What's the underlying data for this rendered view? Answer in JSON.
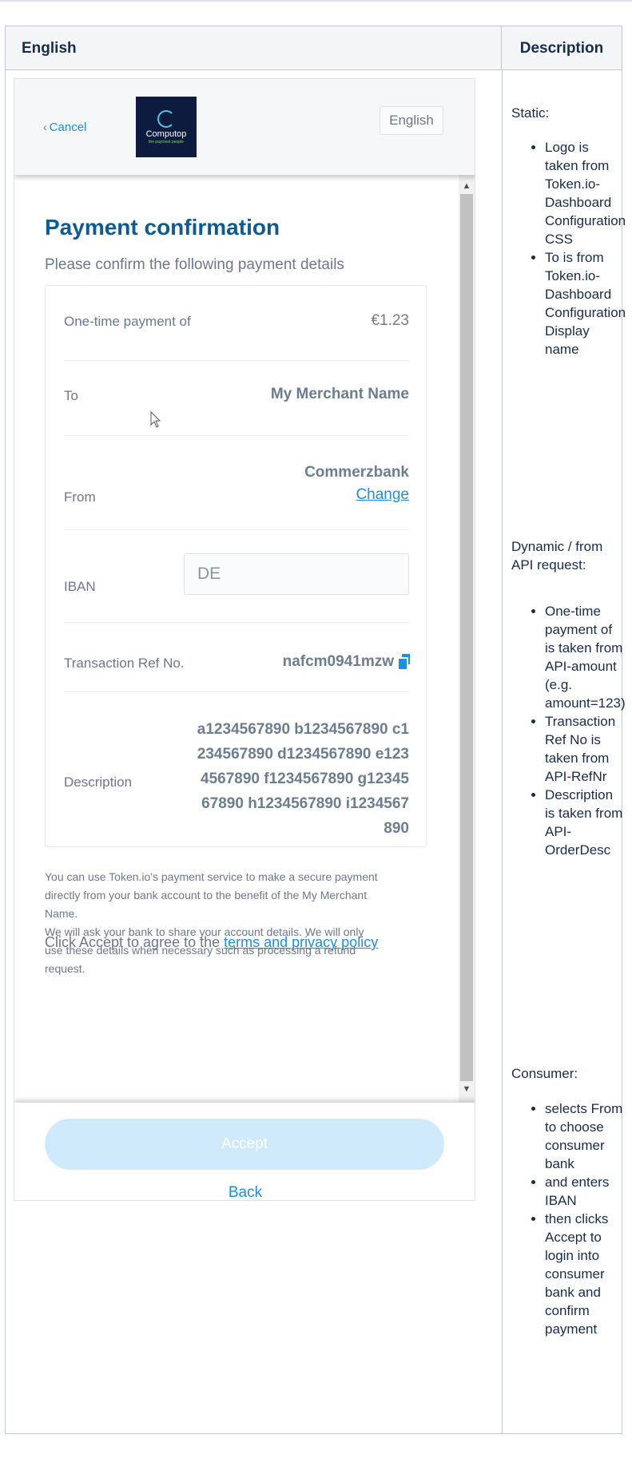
{
  "table": {
    "col_english": "English",
    "col_description": "Description"
  },
  "phone": {
    "header": {
      "cancel_label": "Cancel",
      "logo_name": "Computop",
      "logo_tagline": "the payment people",
      "language_label": "English"
    },
    "title": "Payment confirmation",
    "subtitle": "Please confirm the following payment details",
    "details": {
      "payment_label": "One-time payment of",
      "payment_value": "€1.23",
      "to_label": "To",
      "to_value": "My Merchant Name",
      "from_label": "From",
      "from_value": "Commerzbank",
      "change_label": "Change",
      "iban_label": "IBAN",
      "iban_value": "DE",
      "ref_label": "Transaction Ref No.",
      "ref_value": "nafcm0941mzw",
      "description_label": "Description",
      "description_value": "a1234567890 b1234567890 c1234567890 d1234567890 e1234567890 f1234567890 g1234567890 h1234567890 i1234567890"
    },
    "info_line1": "You can use Token.io's payment service to make a secure payment directly from your bank account to the benefit of the My Merchant Name.",
    "info_line2": "We will ask your bank to share your account details. We will only use these details when necessary such as processing a refund request.",
    "accept_prefix": "Click Accept to agree to the ",
    "terms_link": "terms and privacy policy",
    "accept_button": "Accept",
    "back_link": "Back"
  },
  "description": {
    "static_heading": "Static:",
    "static_items": [
      "Logo is taken from Token.io-Dashboard Configuration CSS",
      "To is from Token.io-Dashboard Configuration Display name"
    ],
    "dynamic_heading": "Dynamic / from API request:",
    "dynamic_items": [
      "One-time payment of is taken from API-amount (e.g. amount=123)",
      "Transaction Ref No is taken from API-RefNr",
      "Description is taken from API-OrderDesc"
    ],
    "consumer_heading": "Consumer:",
    "consumer_items": [
      "selects From to choose consumer bank",
      "and enters IBAN",
      "then clicks Accept to login into consumer bank and confirm payment"
    ]
  },
  "colors": {
    "accent": "#1a8fe3",
    "title": "#0e5a91",
    "accept_disabled": "#cfeafb"
  }
}
